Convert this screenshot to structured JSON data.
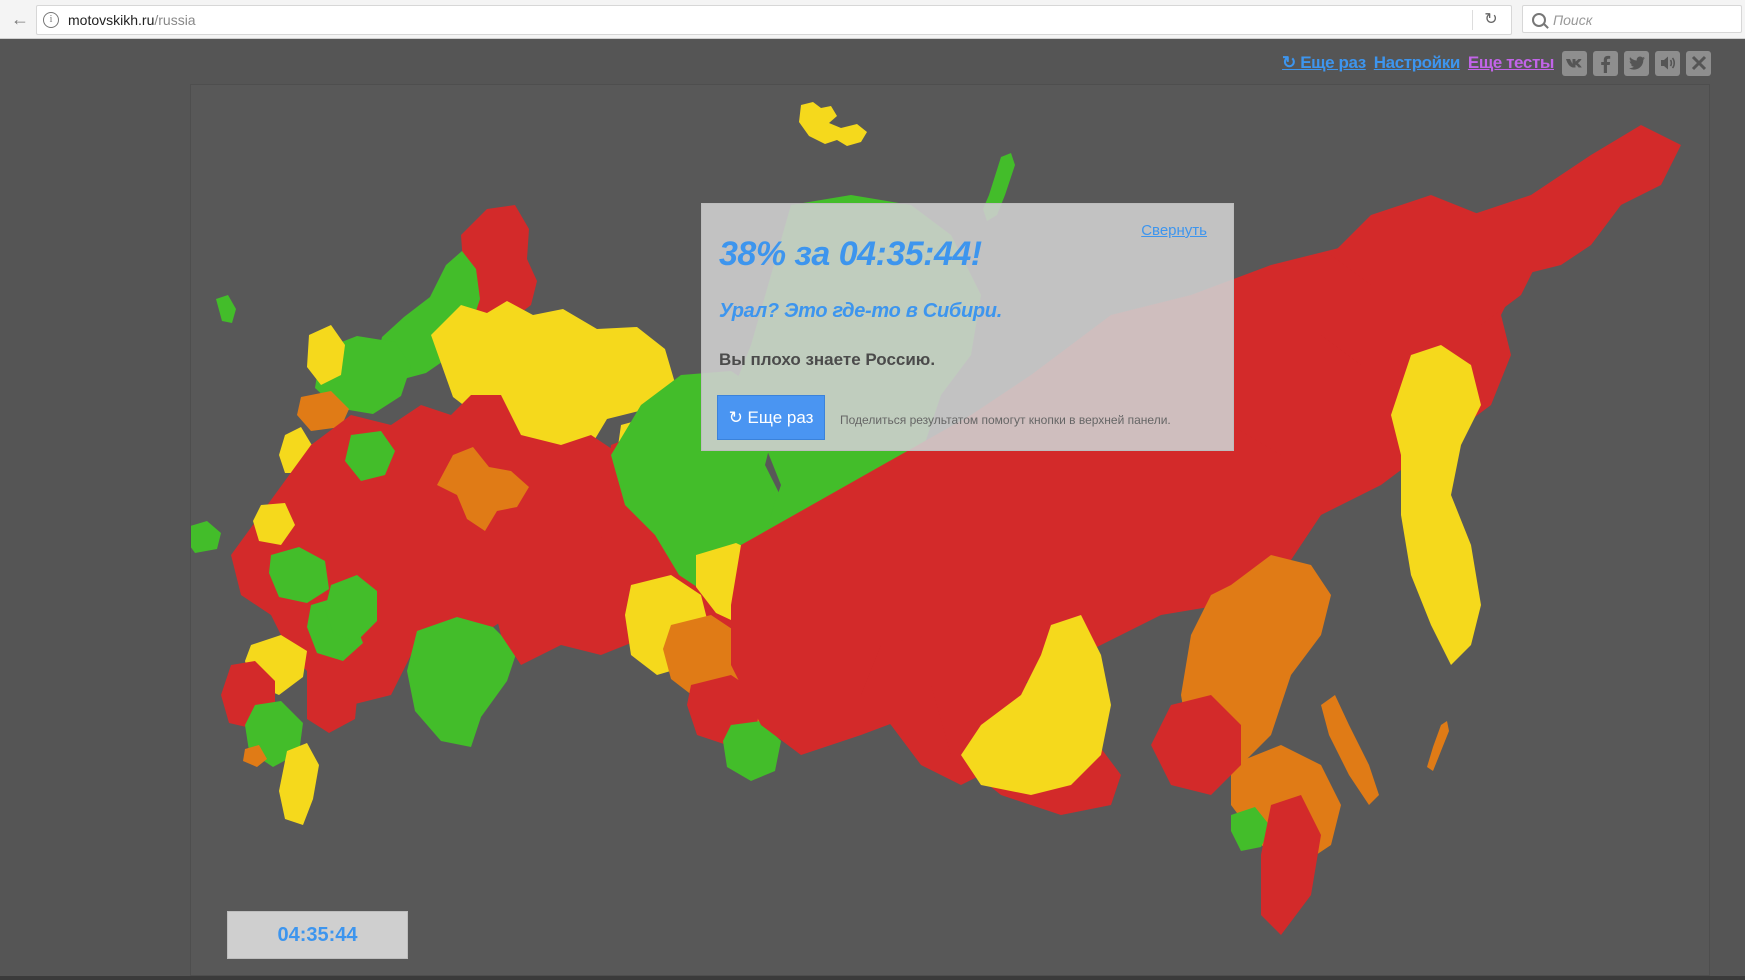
{
  "browser": {
    "url_host": "motovskikh.ru",
    "url_path": "/russia",
    "search_placeholder": "Поиск"
  },
  "nav": {
    "again_label": "↻ Еще раз",
    "settings_label": "Настройки",
    "more_tests_label": "Еще тесты",
    "social_icons": [
      "vk-icon",
      "facebook-icon",
      "twitter-icon",
      "sound-icon",
      "close-icon"
    ]
  },
  "result": {
    "collapse_label": "Свернуть",
    "title": "38% за 04:35:44!",
    "subtitle": "Урал? Это где-то в Сибири.",
    "verdict": "Вы плохо знаете Россию.",
    "again_button_label": "↻ Еще раз",
    "share_hint": "Поделиться результатом помогут кнопки в верхней панели."
  },
  "timer": {
    "value": "04:35:44"
  },
  "colors": {
    "correct": "#43bd2a",
    "wrong": "#d32a2a",
    "hint1": "#f5d91c",
    "hint2": "#e07b16",
    "accent": "#3d95ee",
    "more_tests": "#c264e8"
  }
}
